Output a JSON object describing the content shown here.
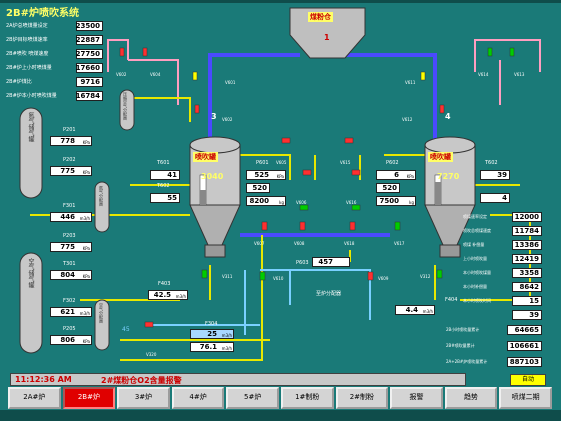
{
  "title": "2B#炉喷吹系统",
  "left_summary": [
    {
      "label": "2A炉总喷煤量设定",
      "value": "23500"
    },
    {
      "label": "2B炉目标喷煤速率",
      "value": "22887"
    },
    {
      "label": "2B#喷吹 喷煤速度",
      "value": "27750"
    },
    {
      "label": "2B#炉上小时喷煤量",
      "value": "17660"
    },
    {
      "label": "2B#炉煤比",
      "value": "9716"
    },
    {
      "label": "2B#炉本小时喷吹煤量",
      "value": "16784"
    }
  ],
  "tank_labels": [
    "氮气储气罐",
    "空气储气罐"
  ],
  "small_tank_labels": [
    "压缩空气分配器",
    "氮气分配器",
    "空气分配器"
  ],
  "left_pressures": [
    {
      "tag": "P201",
      "value": "778",
      "unit": "KPa"
    },
    {
      "tag": "P202",
      "value": "775",
      "unit": "KPa"
    },
    {
      "tag": "F301",
      "value": "446",
      "unit": "m3/h"
    },
    {
      "tag": "P203",
      "value": "775",
      "unit": "KPa"
    },
    {
      "tag": "T301",
      "value": "804",
      "unit": "KPa"
    },
    {
      "tag": "F302",
      "value": "621",
      "unit": "m3/h"
    },
    {
      "tag": "P205",
      "value": "806",
      "unit": "KPa"
    }
  ],
  "valves": {
    "v602": "V602",
    "v604": "V604",
    "v601": "V601",
    "v602b": "V602",
    "v611": "V611",
    "v612": "V612",
    "v614": "V614",
    "v613": "V613",
    "v605": "V605",
    "v615": "V615",
    "v606": "V606",
    "v616": "V616",
    "v607": "V607",
    "v608": "V608",
    "v618": "V618",
    "v617": "V617",
    "v311": "V311",
    "v610": "V610",
    "v609": "V609",
    "v312": "V312",
    "v320": "V320"
  },
  "hopper": {
    "label": "煤粉仓",
    "number": "1"
  },
  "line_numbers": {
    "left": "3",
    "right": "4"
  },
  "left_tank": {
    "label": "喷吹罐",
    "weight": "3040",
    "t601_tag": "T601",
    "t601_value": "41",
    "t602_tag": "T602",
    "t602_value": "55"
  },
  "right_tank": {
    "label": "喷吹罐",
    "weight": "7270",
    "t602_tag": "T602",
    "t602_value": "39",
    "t603_value": "4"
  },
  "center_left": {
    "tag": "P601",
    "pressure": "525",
    "pressure_unit": "KPa",
    "value2": "520",
    "value3": "8200",
    "value3_unit": "kg"
  },
  "center_right": {
    "tag": "P602",
    "pressure": "6",
    "pressure_unit": "KPa",
    "value2": "520",
    "value3": "7500",
    "value3_unit": "kg"
  },
  "center_flow": {
    "tag": "P603",
    "value": "457",
    "label": "至炉分配器"
  },
  "lower_left": {
    "tag": "F403",
    "value": "42.5",
    "unit": "m3/h"
  },
  "lower_right": {
    "tag": "F404",
    "value": "4.4",
    "unit": "m3/h"
  },
  "bottom_flows": {
    "tag": "F304",
    "value1": "25",
    "value2": "76.1",
    "unit": "m3/h"
  },
  "angle": "45",
  "right_panel": [
    {
      "label": "喷煤速率设定",
      "value": "12000"
    },
    {
      "label": "喷吹总喷煤速度",
      "value": "11784"
    },
    {
      "label": "喷煤 补偿量",
      "value": "13386"
    },
    {
      "label": "上小时喷吹量",
      "value": "12419"
    },
    {
      "label": "本小时喷吹煤量",
      "value": "3358"
    },
    {
      "label": "本小时补偿量",
      "value": "8642"
    },
    {
      "label": "本小时喷吹时间",
      "value": "15"
    },
    {
      "value": "39"
    }
  ],
  "right_totals": [
    {
      "label": "2B小时喷吹量累计",
      "value": "64665"
    },
    {
      "label": "2B#喷吹量累计",
      "value": "106661"
    },
    {
      "label": "2A+2B#炉喷吹量累计",
      "value": "887103"
    }
  ],
  "status": {
    "time": "11:12:36 AM",
    "message": "2#煤粉仓O2含量报警",
    "auto": "自动"
  },
  "nav": [
    "2A#炉",
    "2B#炉",
    "3#炉",
    "4#炉",
    "5#炉",
    "1#制粉",
    "2#制粉",
    "报警",
    "趋势",
    "喷煤二期"
  ],
  "colors": {
    "background": "#1a7a78",
    "active_tab": "#e00000",
    "alarm_text": "#cc0000",
    "pipe_coal": "#4a4aff",
    "pipe_yellow": "#e8e800",
    "pipe_air": "#ff9ec0",
    "pipe_lightblue": "#7ad0ff"
  }
}
